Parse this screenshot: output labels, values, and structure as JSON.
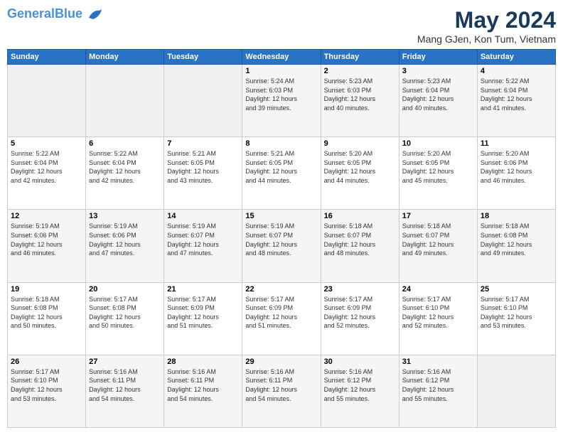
{
  "header": {
    "logo_line1": "General",
    "logo_line2": "Blue",
    "title": "May 2024",
    "subtitle": "Mang GJen, Kon Tum, Vietnam"
  },
  "days_of_week": [
    "Sunday",
    "Monday",
    "Tuesday",
    "Wednesday",
    "Thursday",
    "Friday",
    "Saturday"
  ],
  "weeks": [
    [
      {
        "day": "",
        "detail": ""
      },
      {
        "day": "",
        "detail": ""
      },
      {
        "day": "",
        "detail": ""
      },
      {
        "day": "1",
        "detail": "Sunrise: 5:24 AM\nSunset: 6:03 PM\nDaylight: 12 hours\nand 39 minutes."
      },
      {
        "day": "2",
        "detail": "Sunrise: 5:23 AM\nSunset: 6:03 PM\nDaylight: 12 hours\nand 40 minutes."
      },
      {
        "day": "3",
        "detail": "Sunrise: 5:23 AM\nSunset: 6:04 PM\nDaylight: 12 hours\nand 40 minutes."
      },
      {
        "day": "4",
        "detail": "Sunrise: 5:22 AM\nSunset: 6:04 PM\nDaylight: 12 hours\nand 41 minutes."
      }
    ],
    [
      {
        "day": "5",
        "detail": "Sunrise: 5:22 AM\nSunset: 6:04 PM\nDaylight: 12 hours\nand 42 minutes."
      },
      {
        "day": "6",
        "detail": "Sunrise: 5:22 AM\nSunset: 6:04 PM\nDaylight: 12 hours\nand 42 minutes."
      },
      {
        "day": "7",
        "detail": "Sunrise: 5:21 AM\nSunset: 6:05 PM\nDaylight: 12 hours\nand 43 minutes."
      },
      {
        "day": "8",
        "detail": "Sunrise: 5:21 AM\nSunset: 6:05 PM\nDaylight: 12 hours\nand 44 minutes."
      },
      {
        "day": "9",
        "detail": "Sunrise: 5:20 AM\nSunset: 6:05 PM\nDaylight: 12 hours\nand 44 minutes."
      },
      {
        "day": "10",
        "detail": "Sunrise: 5:20 AM\nSunset: 6:05 PM\nDaylight: 12 hours\nand 45 minutes."
      },
      {
        "day": "11",
        "detail": "Sunrise: 5:20 AM\nSunset: 6:06 PM\nDaylight: 12 hours\nand 46 minutes."
      }
    ],
    [
      {
        "day": "12",
        "detail": "Sunrise: 5:19 AM\nSunset: 6:06 PM\nDaylight: 12 hours\nand 46 minutes."
      },
      {
        "day": "13",
        "detail": "Sunrise: 5:19 AM\nSunset: 6:06 PM\nDaylight: 12 hours\nand 47 minutes."
      },
      {
        "day": "14",
        "detail": "Sunrise: 5:19 AM\nSunset: 6:07 PM\nDaylight: 12 hours\nand 47 minutes."
      },
      {
        "day": "15",
        "detail": "Sunrise: 5:19 AM\nSunset: 6:07 PM\nDaylight: 12 hours\nand 48 minutes."
      },
      {
        "day": "16",
        "detail": "Sunrise: 5:18 AM\nSunset: 6:07 PM\nDaylight: 12 hours\nand 48 minutes."
      },
      {
        "day": "17",
        "detail": "Sunrise: 5:18 AM\nSunset: 6:07 PM\nDaylight: 12 hours\nand 49 minutes."
      },
      {
        "day": "18",
        "detail": "Sunrise: 5:18 AM\nSunset: 6:08 PM\nDaylight: 12 hours\nand 49 minutes."
      }
    ],
    [
      {
        "day": "19",
        "detail": "Sunrise: 5:18 AM\nSunset: 6:08 PM\nDaylight: 12 hours\nand 50 minutes."
      },
      {
        "day": "20",
        "detail": "Sunrise: 5:17 AM\nSunset: 6:08 PM\nDaylight: 12 hours\nand 50 minutes."
      },
      {
        "day": "21",
        "detail": "Sunrise: 5:17 AM\nSunset: 6:09 PM\nDaylight: 12 hours\nand 51 minutes."
      },
      {
        "day": "22",
        "detail": "Sunrise: 5:17 AM\nSunset: 6:09 PM\nDaylight: 12 hours\nand 51 minutes."
      },
      {
        "day": "23",
        "detail": "Sunrise: 5:17 AM\nSunset: 6:09 PM\nDaylight: 12 hours\nand 52 minutes."
      },
      {
        "day": "24",
        "detail": "Sunrise: 5:17 AM\nSunset: 6:10 PM\nDaylight: 12 hours\nand 52 minutes."
      },
      {
        "day": "25",
        "detail": "Sunrise: 5:17 AM\nSunset: 6:10 PM\nDaylight: 12 hours\nand 53 minutes."
      }
    ],
    [
      {
        "day": "26",
        "detail": "Sunrise: 5:17 AM\nSunset: 6:10 PM\nDaylight: 12 hours\nand 53 minutes."
      },
      {
        "day": "27",
        "detail": "Sunrise: 5:16 AM\nSunset: 6:11 PM\nDaylight: 12 hours\nand 54 minutes."
      },
      {
        "day": "28",
        "detail": "Sunrise: 5:16 AM\nSunset: 6:11 PM\nDaylight: 12 hours\nand 54 minutes."
      },
      {
        "day": "29",
        "detail": "Sunrise: 5:16 AM\nSunset: 6:11 PM\nDaylight: 12 hours\nand 54 minutes."
      },
      {
        "day": "30",
        "detail": "Sunrise: 5:16 AM\nSunset: 6:12 PM\nDaylight: 12 hours\nand 55 minutes."
      },
      {
        "day": "31",
        "detail": "Sunrise: 5:16 AM\nSunset: 6:12 PM\nDaylight: 12 hours\nand 55 minutes."
      },
      {
        "day": "",
        "detail": ""
      }
    ]
  ]
}
